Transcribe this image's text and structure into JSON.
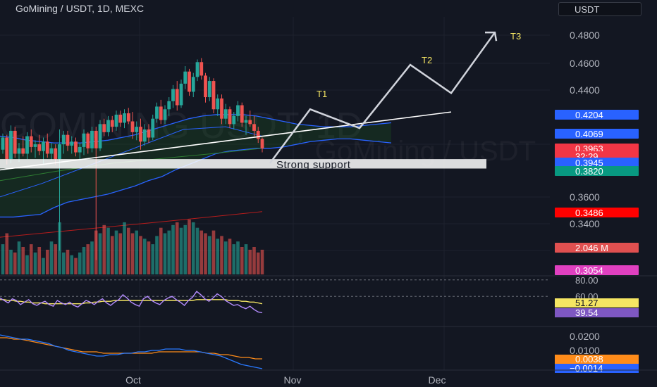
{
  "header": {
    "title": "GoMining / USDT, 1D, MEXC",
    "currency_button": "USDT"
  },
  "watermark": "GOMINING USDT, 1D",
  "watermark_sub": "GoMining / USDT",
  "colors": {
    "background": "#131722",
    "up": "#26a69a",
    "down": "#ef5350",
    "cloud_line": "#2962ff",
    "cloud_fill": "#1b5e20",
    "annotation": "#d1d4dc",
    "target_label": "#f5e663",
    "rsi": "#b48cff",
    "rsi_ma": "#f5e663",
    "macd": "#2979ff",
    "signal": "#ff8c1a"
  },
  "chart_data": {
    "type": "candlestick",
    "x_ticks": [
      "Oct",
      "Nov",
      "Dec"
    ],
    "price_axis": {
      "ticks": [
        "0.4800",
        "0.4600",
        "0.4400",
        "0.3600",
        "0.3400"
      ],
      "ylim": [
        0.3,
        0.49
      ],
      "badges": [
        {
          "label": "0.4204",
          "color": "#2962ff",
          "value": 0.4204
        },
        {
          "label": "0.4069",
          "color": "#2962ff",
          "value": 0.4069
        },
        {
          "label": "0.3963",
          "color": "#f23645",
          "value": 0.3963
        },
        {
          "label": "32:29",
          "color": "#f23645",
          "value": 0.3925
        },
        {
          "label": "0.3945",
          "color": "#2962ff",
          "value": 0.3945
        },
        {
          "label": "0.3820",
          "color": "#089981",
          "value": 0.382
        },
        {
          "label": "0.3486",
          "color": "#ff0000",
          "value": 0.3486
        },
        {
          "label": "2.046 M",
          "color": "#e05050",
          "value": 0.327
        },
        {
          "label": "0.3054",
          "color": "#e040c0",
          "value": 0.3054
        }
      ]
    },
    "candles": [
      [
        0.395,
        0.407,
        0.392,
        0.404
      ],
      [
        0.404,
        0.406,
        0.384,
        0.388
      ],
      [
        0.388,
        0.413,
        0.385,
        0.409
      ],
      [
        0.409,
        0.412,
        0.389,
        0.392
      ],
      [
        0.392,
        0.4,
        0.386,
        0.396
      ],
      [
        0.396,
        0.405,
        0.39,
        0.392
      ],
      [
        0.392,
        0.408,
        0.388,
        0.405
      ],
      [
        0.405,
        0.41,
        0.393,
        0.397
      ],
      [
        0.397,
        0.402,
        0.389,
        0.399
      ],
      [
        0.399,
        0.406,
        0.391,
        0.394
      ],
      [
        0.394,
        0.404,
        0.384,
        0.401
      ],
      [
        0.401,
        0.407,
        0.389,
        0.392
      ],
      [
        0.392,
        0.4,
        0.387,
        0.396
      ],
      [
        0.396,
        0.399,
        0.384,
        0.388
      ],
      [
        0.388,
        0.41,
        0.32,
        0.399
      ],
      [
        0.399,
        0.409,
        0.392,
        0.406
      ],
      [
        0.406,
        0.409,
        0.394,
        0.398
      ],
      [
        0.398,
        0.405,
        0.392,
        0.401
      ],
      [
        0.401,
        0.404,
        0.39,
        0.393
      ],
      [
        0.393,
        0.4,
        0.388,
        0.397
      ],
      [
        0.397,
        0.41,
        0.391,
        0.407
      ],
      [
        0.407,
        0.408,
        0.392,
        0.396
      ],
      [
        0.396,
        0.412,
        0.393,
        0.409
      ],
      [
        0.409,
        0.412,
        0.313,
        0.396
      ],
      [
        0.396,
        0.417,
        0.394,
        0.414
      ],
      [
        0.414,
        0.418,
        0.405,
        0.408
      ],
      [
        0.408,
        0.42,
        0.405,
        0.417
      ],
      [
        0.417,
        0.42,
        0.408,
        0.412
      ],
      [
        0.412,
        0.424,
        0.409,
        0.421
      ],
      [
        0.421,
        0.424,
        0.412,
        0.415
      ],
      [
        0.415,
        0.425,
        0.411,
        0.422
      ],
      [
        0.422,
        0.426,
        0.414,
        0.416
      ],
      [
        0.416,
        0.423,
        0.403,
        0.408
      ],
      [
        0.408,
        0.416,
        0.402,
        0.412
      ],
      [
        0.412,
        0.418,
        0.395,
        0.401
      ],
      [
        0.401,
        0.414,
        0.398,
        0.41
      ],
      [
        0.41,
        0.414,
        0.4,
        0.404
      ],
      [
        0.404,
        0.421,
        0.402,
        0.418
      ],
      [
        0.418,
        0.43,
        0.415,
        0.427
      ],
      [
        0.427,
        0.432,
        0.414,
        0.417
      ],
      [
        0.417,
        0.428,
        0.414,
        0.425
      ],
      [
        0.425,
        0.434,
        0.42,
        0.431
      ],
      [
        0.431,
        0.443,
        0.426,
        0.44
      ],
      [
        0.44,
        0.446,
        0.424,
        0.428
      ],
      [
        0.428,
        0.447,
        0.426,
        0.444
      ],
      [
        0.444,
        0.457,
        0.44,
        0.453
      ],
      [
        0.453,
        0.455,
        0.435,
        0.438
      ],
      [
        0.438,
        0.452,
        0.434,
        0.449
      ],
      [
        0.449,
        0.462,
        0.446,
        0.46
      ],
      [
        0.46,
        0.463,
        0.447,
        0.45
      ],
      [
        0.45,
        0.452,
        0.43,
        0.434
      ],
      [
        0.434,
        0.449,
        0.431,
        0.446
      ],
      [
        0.446,
        0.448,
        0.422,
        0.425
      ],
      [
        0.425,
        0.436,
        0.42,
        0.433
      ],
      [
        0.433,
        0.436,
        0.414,
        0.418
      ],
      [
        0.418,
        0.429,
        0.414,
        0.425
      ],
      [
        0.425,
        0.427,
        0.411,
        0.414
      ],
      [
        0.414,
        0.423,
        0.41,
        0.42
      ],
      [
        0.42,
        0.431,
        0.416,
        0.428
      ],
      [
        0.428,
        0.43,
        0.412,
        0.415
      ],
      [
        0.415,
        0.42,
        0.406,
        0.417
      ],
      [
        0.417,
        0.424,
        0.412,
        0.414
      ],
      [
        0.414,
        0.42,
        0.405,
        0.409
      ],
      [
        0.409,
        0.412,
        0.4,
        0.403
      ],
      [
        0.403,
        0.404,
        0.393,
        0.396
      ]
    ],
    "volume": [
      0.55,
      0.75,
      0.45,
      0.4,
      0.6,
      0.5,
      0.35,
      0.55,
      0.4,
      0.5,
      0.3,
      0.45,
      0.6,
      0.55,
      0.95,
      0.4,
      0.45,
      0.35,
      0.3,
      0.4,
      0.5,
      0.55,
      0.6,
      0.8,
      0.75,
      0.9,
      0.85,
      0.7,
      0.8,
      0.75,
      0.95,
      0.85,
      0.75,
      0.8,
      0.7,
      0.65,
      0.6,
      0.55,
      0.7,
      0.85,
      0.75,
      0.8,
      0.9,
      0.95,
      0.85,
      0.9,
      1.0,
      0.95,
      0.85,
      0.8,
      0.75,
      0.7,
      0.8,
      0.65,
      0.7,
      0.6,
      0.65,
      0.55,
      0.6,
      0.5,
      0.55,
      0.45,
      0.5,
      0.4,
      0.45
    ],
    "ichimoku_upper": [
      0.405,
      0.404,
      0.402,
      0.401,
      0.4,
      0.4,
      0.4,
      0.401,
      0.402,
      0.404,
      0.406,
      0.409,
      0.412,
      0.415,
      0.418,
      0.42,
      0.421,
      0.421,
      0.421,
      0.42,
      0.418,
      0.416,
      0.414,
      0.413,
      0.412,
      0.412,
      0.412,
      0.413,
      0.414,
      0.415
    ],
    "ichimoku_lower": [
      0.345,
      0.345,
      0.346,
      0.347,
      0.352,
      0.356,
      0.358,
      0.36,
      0.362,
      0.365,
      0.368,
      0.372,
      0.375,
      0.38,
      0.384,
      0.388,
      0.392,
      0.394,
      0.395,
      0.396,
      0.396,
      0.397,
      0.399,
      0.401,
      0.402,
      0.403,
      0.403,
      0.402,
      0.401,
      0.4
    ],
    "annotations": {
      "support_label": "Strong support",
      "targets": [
        "T1",
        "T2",
        "T3"
      ],
      "projection": [
        [
          0,
          0.385
        ],
        [
          1,
          0.425
        ],
        [
          2,
          0.411
        ],
        [
          3,
          0.458
        ],
        [
          4,
          0.437
        ],
        [
          5,
          0.482
        ]
      ]
    },
    "rsi": {
      "ticks": [
        "80.00",
        "60.00"
      ],
      "ylim": [
        25,
        85
      ],
      "value_label": "39.54",
      "ma_label": "51.27",
      "values": [
        58,
        55,
        52,
        57,
        55,
        50,
        53,
        56,
        51,
        49,
        52,
        54,
        50,
        48,
        55,
        52,
        50,
        53,
        49,
        47,
        51,
        55,
        53,
        50,
        54,
        57,
        52,
        49,
        53,
        56,
        62,
        58,
        53,
        50,
        48,
        57,
        60,
        55,
        52,
        50,
        55,
        58,
        60,
        56,
        53,
        49,
        55,
        59,
        66,
        62,
        57,
        54,
        58,
        63,
        60,
        55,
        52,
        49,
        50,
        47,
        45,
        48,
        44,
        41,
        40
      ],
      "ma": [
        56,
        56,
        55,
        55,
        54,
        54,
        53,
        53,
        52,
        52,
        52,
        51,
        51,
        51,
        51,
        51,
        51,
        51,
        51,
        51,
        51,
        52,
        52,
        53,
        53,
        54,
        54,
        54,
        55,
        55,
        55,
        55,
        55,
        55,
        55,
        55,
        55,
        55,
        55,
        55,
        55,
        55,
        55,
        55,
        55,
        55,
        55,
        55,
        56,
        56,
        56,
        56,
        56,
        56,
        56,
        56,
        55,
        55,
        55,
        54,
        54,
        53,
        53,
        52,
        51
      ]
    },
    "macd": {
      "ticks": [
        "0.0200",
        "0.0100"
      ],
      "ylim": [
        -0.004,
        0.028
      ],
      "macd_label": "0.0038",
      "signal_label": "−0.0014",
      "macd_values": [
        0.021,
        0.02,
        0.019,
        0.018,
        0.018,
        0.017,
        0.016,
        0.015,
        0.013,
        0.012,
        0.01,
        0.009,
        0.008,
        0.007,
        0.006,
        0.006,
        0.007,
        0.007,
        0.008,
        0.008,
        0.009,
        0.009,
        0.01,
        0.01,
        0.011,
        0.011,
        0.011,
        0.01,
        0.01,
        0.009,
        0.008,
        0.007,
        0.006,
        0.004,
        0.002,
        0.0,
        -0.001,
        -0.002,
        -0.003
      ],
      "signal_values": [
        0.019,
        0.019,
        0.018,
        0.018,
        0.017,
        0.016,
        0.015,
        0.014,
        0.013,
        0.012,
        0.011,
        0.01,
        0.009,
        0.009,
        0.009,
        0.008,
        0.008,
        0.008,
        0.008,
        0.008,
        0.008,
        0.008,
        0.008,
        0.009,
        0.009,
        0.009,
        0.009,
        0.009,
        0.009,
        0.009,
        0.008,
        0.008,
        0.007,
        0.007,
        0.006,
        0.005,
        0.005,
        0.004,
        0.004
      ]
    }
  }
}
